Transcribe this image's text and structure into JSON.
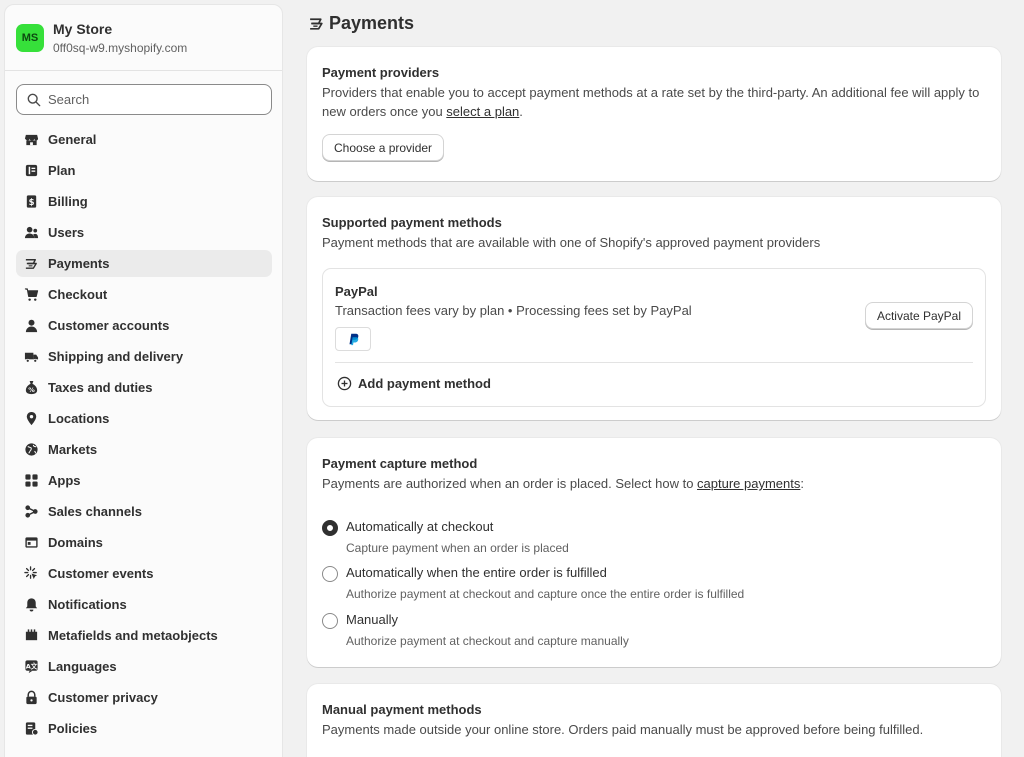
{
  "store": {
    "initials": "MS",
    "name": "My Store",
    "domain": "0ff0sq-w9.myshopify.com"
  },
  "search": {
    "placeholder": "Search"
  },
  "sidebar": {
    "items": [
      {
        "label": "General",
        "icon": "store-icon"
      },
      {
        "label": "Plan",
        "icon": "plan-icon"
      },
      {
        "label": "Billing",
        "icon": "billing-icon"
      },
      {
        "label": "Users",
        "icon": "users-icon"
      },
      {
        "label": "Payments",
        "icon": "payments-icon",
        "active": true
      },
      {
        "label": "Checkout",
        "icon": "cart-icon"
      },
      {
        "label": "Customer accounts",
        "icon": "person-icon"
      },
      {
        "label": "Shipping and delivery",
        "icon": "truck-icon"
      },
      {
        "label": "Taxes and duties",
        "icon": "taxes-icon"
      },
      {
        "label": "Locations",
        "icon": "location-icon"
      },
      {
        "label": "Markets",
        "icon": "globe-icon"
      },
      {
        "label": "Apps",
        "icon": "apps-icon"
      },
      {
        "label": "Sales channels",
        "icon": "channels-icon"
      },
      {
        "label": "Domains",
        "icon": "domains-icon"
      },
      {
        "label": "Customer events",
        "icon": "events-icon"
      },
      {
        "label": "Notifications",
        "icon": "bell-icon"
      },
      {
        "label": "Metafields and metaobjects",
        "icon": "metafields-icon"
      },
      {
        "label": "Languages",
        "icon": "languages-icon"
      },
      {
        "label": "Customer privacy",
        "icon": "lock-icon"
      },
      {
        "label": "Policies",
        "icon": "policies-icon"
      }
    ]
  },
  "page": {
    "title": "Payments"
  },
  "providers": {
    "title": "Payment providers",
    "desc_before": "Providers that enable you to accept payment methods at a rate set by the third-party. An additional fee will apply to new orders once you ",
    "link": "select a plan",
    "desc_after": ".",
    "button": "Choose a provider"
  },
  "supported": {
    "title": "Supported payment methods",
    "desc": "Payment methods that are available with one of Shopify's approved payment providers",
    "method_name": "PayPal",
    "method_fees": "Transaction fees vary by plan • Processing fees set by PayPal",
    "logo_text": "P",
    "activate_button": "Activate PayPal",
    "add_label": "Add payment method"
  },
  "capture": {
    "title": "Payment capture method",
    "desc_before": "Payments are authorized when an order is placed. Select how to ",
    "link": "capture payments",
    "desc_after": ":",
    "options": [
      {
        "label": "Automatically at checkout",
        "help": "Capture payment when an order is placed",
        "checked": true
      },
      {
        "label": "Automatically when the entire order is fulfilled",
        "help": "Authorize payment at checkout and capture once the entire order is fulfilled",
        "checked": false
      },
      {
        "label": "Manually",
        "help": "Authorize payment at checkout and capture manually",
        "checked": false
      }
    ]
  },
  "manual": {
    "title": "Manual payment methods",
    "desc": "Payments made outside your online store. Orders paid manually must be approved before being fulfilled."
  },
  "colors": {
    "accent": "#303030",
    "avatar_bg": "#36e03a",
    "paypal_blue": "#003087",
    "paypal_light": "#009cde"
  }
}
